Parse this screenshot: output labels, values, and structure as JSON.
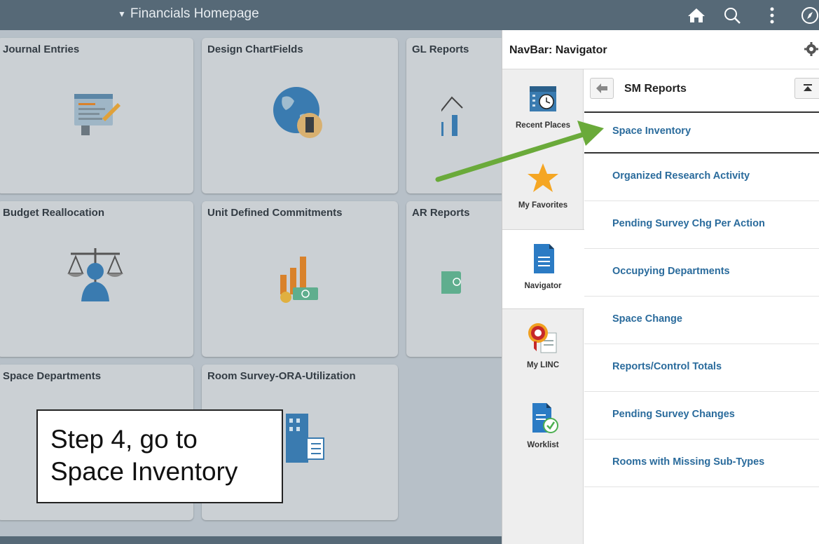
{
  "header": {
    "title": "Financials Homepage",
    "icons": [
      "home-icon",
      "search-icon",
      "more-options-icon",
      "navbar-compass-icon"
    ]
  },
  "tiles": [
    {
      "title": "Journal Entries",
      "icon": "journal-entries-icon"
    },
    {
      "title": "Design ChartFields",
      "icon": "globe-building-icon"
    },
    {
      "title": "GL Reports",
      "icon": "line-chart-icon"
    },
    {
      "title": "Budget Reallocation",
      "icon": "scales-person-icon"
    },
    {
      "title": "Unit Defined Commitments",
      "icon": "bar-chart-money-icon"
    },
    {
      "title": "AR Reports",
      "icon": "money-report-icon"
    },
    {
      "title": "Space Departments",
      "icon": "space-departments-icon"
    },
    {
      "title": "Room Survey-ORA-Utilization",
      "icon": "building-survey-icon"
    }
  ],
  "callout": {
    "line1": "Step 4, go to",
    "line2": "Space Inventory"
  },
  "panel": {
    "title": "NavBar: Navigator",
    "sidebar": [
      {
        "label": "Recent Places",
        "icon": "calendar-clock-icon"
      },
      {
        "label": "My Favorites",
        "icon": "star-icon"
      },
      {
        "label": "Navigator",
        "icon": "document-icon"
      },
      {
        "label": "My LINC",
        "icon": "ribbon-badge-icon"
      },
      {
        "label": "Worklist",
        "icon": "worklist-check-icon"
      }
    ],
    "list_title": "SM Reports",
    "items": [
      "Space Inventory",
      "Organized Research Activity",
      "Pending Survey Chg Per Action",
      "Occupying Departments",
      "Space Change",
      "Reports/Control Totals",
      "Pending Survey Changes",
      "Rooms with Missing Sub-Types"
    ]
  },
  "colors": {
    "header": "#566977",
    "link": "#2a6b9c",
    "arrow": "#6aaa3a",
    "star": "#f5a623"
  }
}
